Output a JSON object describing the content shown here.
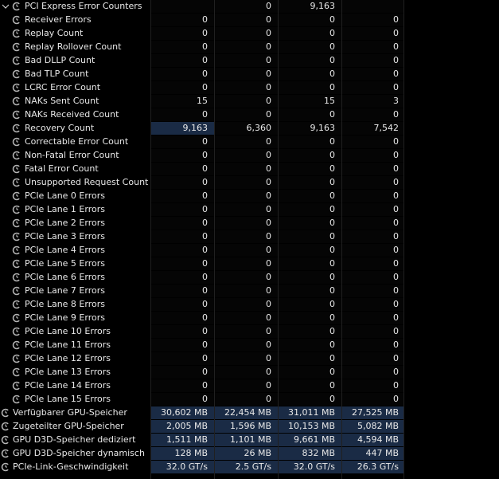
{
  "group": {
    "label": "PCI Express Error Counters",
    "values": [
      "",
      "0",
      "9,163",
      ""
    ]
  },
  "rows": [
    {
      "label": "Receiver Errors",
      "values": [
        "0",
        "0",
        "0",
        "0"
      ]
    },
    {
      "label": "Replay Count",
      "values": [
        "0",
        "0",
        "0",
        "0"
      ]
    },
    {
      "label": "Replay Rollover Count",
      "values": [
        "0",
        "0",
        "0",
        "0"
      ]
    },
    {
      "label": "Bad DLLP Count",
      "values": [
        "0",
        "0",
        "0",
        "0"
      ]
    },
    {
      "label": "Bad TLP Count",
      "values": [
        "0",
        "0",
        "0",
        "0"
      ]
    },
    {
      "label": "LCRC Error Count",
      "values": [
        "0",
        "0",
        "0",
        "0"
      ]
    },
    {
      "label": "NAKs Sent Count",
      "values": [
        "15",
        "0",
        "15",
        "3"
      ]
    },
    {
      "label": "NAKs Received Count",
      "values": [
        "0",
        "0",
        "0",
        "0"
      ]
    },
    {
      "label": "Recovery Count",
      "values": [
        "9,163",
        "6,360",
        "9,163",
        "7,542"
      ],
      "highlight": true
    },
    {
      "label": "Correctable Error Count",
      "values": [
        "0",
        "0",
        "0",
        "0"
      ]
    },
    {
      "label": "Non-Fatal Error Count",
      "values": [
        "0",
        "0",
        "0",
        "0"
      ]
    },
    {
      "label": "Fatal Error Count",
      "values": [
        "0",
        "0",
        "0",
        "0"
      ]
    },
    {
      "label": "Unsupported Request Count",
      "values": [
        "0",
        "0",
        "0",
        "0"
      ]
    },
    {
      "label": "PCIe Lane 0 Errors",
      "values": [
        "0",
        "0",
        "0",
        "0"
      ]
    },
    {
      "label": "PCIe Lane 1 Errors",
      "values": [
        "0",
        "0",
        "0",
        "0"
      ]
    },
    {
      "label": "PCIe Lane 2 Errors",
      "values": [
        "0",
        "0",
        "0",
        "0"
      ]
    },
    {
      "label": "PCIe Lane 3 Errors",
      "values": [
        "0",
        "0",
        "0",
        "0"
      ]
    },
    {
      "label": "PCIe Lane 4 Errors",
      "values": [
        "0",
        "0",
        "0",
        "0"
      ]
    },
    {
      "label": "PCIe Lane 5 Errors",
      "values": [
        "0",
        "0",
        "0",
        "0"
      ]
    },
    {
      "label": "PCIe Lane 6 Errors",
      "values": [
        "0",
        "0",
        "0",
        "0"
      ]
    },
    {
      "label": "PCIe Lane 7 Errors",
      "values": [
        "0",
        "0",
        "0",
        "0"
      ]
    },
    {
      "label": "PCIe Lane 8 Errors",
      "values": [
        "0",
        "0",
        "0",
        "0"
      ]
    },
    {
      "label": "PCIe Lane 9 Errors",
      "values": [
        "0",
        "0",
        "0",
        "0"
      ]
    },
    {
      "label": "PCIe Lane 10 Errors",
      "values": [
        "0",
        "0",
        "0",
        "0"
      ]
    },
    {
      "label": "PCIe Lane 11 Errors",
      "values": [
        "0",
        "0",
        "0",
        "0"
      ]
    },
    {
      "label": "PCIe Lane 12 Errors",
      "values": [
        "0",
        "0",
        "0",
        "0"
      ]
    },
    {
      "label": "PCIe Lane 13 Errors",
      "values": [
        "0",
        "0",
        "0",
        "0"
      ]
    },
    {
      "label": "PCIe Lane 14 Errors",
      "values": [
        "0",
        "0",
        "0",
        "0"
      ]
    },
    {
      "label": "PCIe Lane 15 Errors",
      "values": [
        "0",
        "0",
        "0",
        "0"
      ]
    }
  ],
  "gpu_rows": [
    {
      "label": "Verfügbarer GPU-Speicher",
      "values": [
        "30,602 MB",
        "22,454 MB",
        "31,011 MB",
        "27,525 MB"
      ],
      "highlight": true
    },
    {
      "label": "Zugeteilter GPU-Speicher",
      "values": [
        "2,005 MB",
        "1,596 MB",
        "10,153 MB",
        "5,082 MB"
      ],
      "highlight": true
    },
    {
      "label": "GPU D3D-Speicher dediziert",
      "values": [
        "1,511 MB",
        "1,101 MB",
        "9,661 MB",
        "4,594 MB"
      ],
      "highlight": true
    },
    {
      "label": "GPU D3D-Speicher dynamisch",
      "values": [
        "128 MB",
        "26 MB",
        "832 MB",
        "447 MB"
      ],
      "highlight": true
    },
    {
      "label": "PCIe-Link-Geschwindigkeit",
      "values": [
        "32.0 GT/s",
        "2.5 GT/s",
        "32.0 GT/s",
        "26.3 GT/s"
      ],
      "highlight": true
    }
  ],
  "icons": {
    "expand": "chevron-down-icon",
    "sensor": "sensor-clock-icon"
  },
  "colors": {
    "background": "#000000",
    "text": "#e8e8e8",
    "highlight": "#1a2b45",
    "icon": "#b4b4b4"
  }
}
